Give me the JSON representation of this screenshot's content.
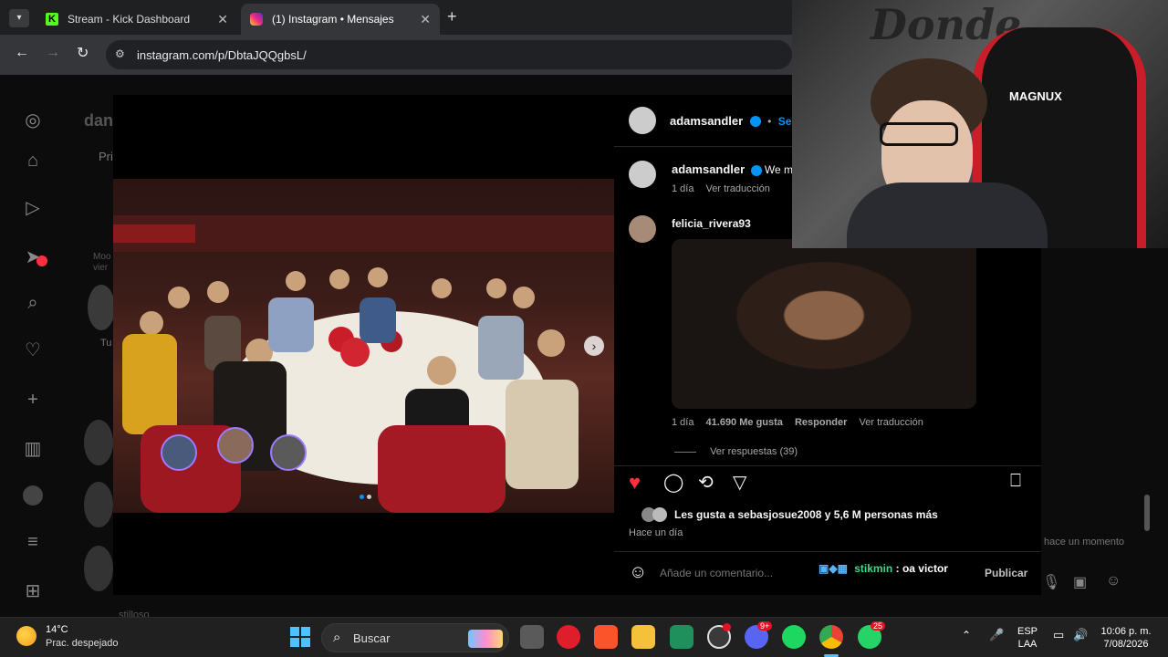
{
  "browser": {
    "tabs": [
      {
        "title": "Stream - Kick Dashboard",
        "active": false
      },
      {
        "title": "(1) Instagram • Mensajes",
        "active": true
      }
    ],
    "url": "instagram.com/p/DbtaJQQgbsL/"
  },
  "instagram": {
    "profile_partial": "dan",
    "tab_partial": "Pri",
    "post_author": "adamsandler",
    "follow_label": "Segu",
    "caption": {
      "author": "adamsandler",
      "text_partial": "We mi",
      "time": "1 día",
      "translate": "Ver traducción"
    },
    "comment": {
      "author": "felicia_rivera93",
      "time": "1 día",
      "likes": "41.690 Me gusta",
      "reply": "Responder",
      "translate": "Ver traducción",
      "view_replies": "Ver respuestas (39)"
    },
    "likes_text_prefix": "Les gusta a ",
    "likes_user": "sebasjosue2008",
    "likes_text_suffix": " y 5,6 M personas más",
    "posted_ago": "Hace un día",
    "comment_placeholder": "Añade un comentario...",
    "publish_label": "Publicar",
    "bg_hint": "hace un momento",
    "bg_name_partial": "stilloso",
    "bg_label_partial": "Tu",
    "bg_moo": "Moo",
    "bg_view": "vier"
  },
  "chat_overlay": {
    "user": "stikmin",
    "message": ": oa victor"
  },
  "webcam_text": {
    "wall": "Donde",
    "chair": "MAGNUX"
  },
  "taskbar": {
    "weather_temp": "14°C",
    "weather_desc": "Prac. despejado",
    "search": "Buscar",
    "lang1": "ESP",
    "lang2": "LAA",
    "time": "10:06 p. m.",
    "date": "7/08/2026",
    "badge_discord": "9+",
    "badge_whatsapp": "25"
  },
  "colors": {
    "accent_blue": "#0095f6",
    "heart_red": "#ff3040",
    "chat_user_green": "#3ddc84"
  }
}
